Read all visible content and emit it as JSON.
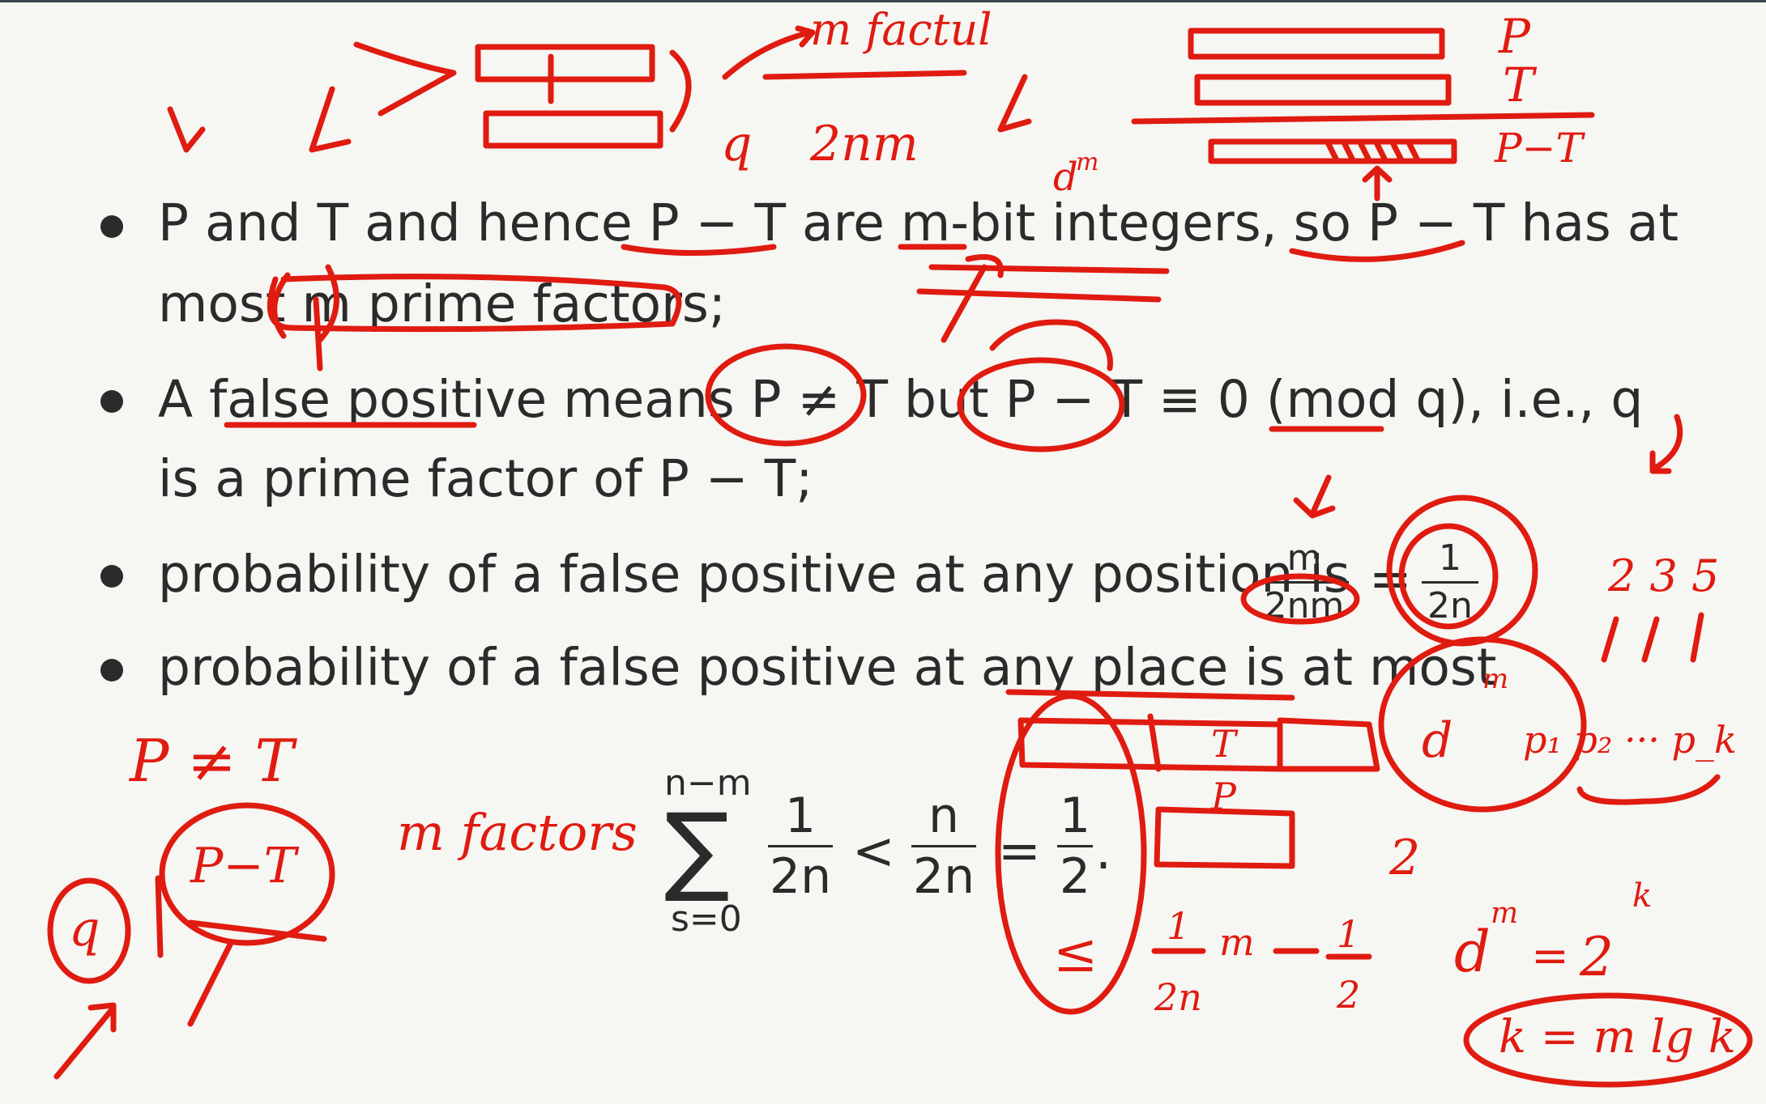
{
  "slide": {
    "bullets": [
      {
        "line1": "P and T and hence P − T are m-bit integers, so P − T has at",
        "line2": "most m prime factors;"
      },
      {
        "line1": "A false positive means P ≠ T but P − T ≡ 0 (mod q), i.e., q",
        "line2": "is a prime factor of P − T;"
      },
      {
        "line1": "probability of a false positive at any position is",
        "frac1_num": "m",
        "frac1_den": "2nm",
        "equals": "=",
        "frac2_num": "1",
        "frac2_den": "2n"
      },
      {
        "line1": "probability of a false positive at any place is at most"
      }
    ],
    "sum": {
      "upper": "n−m",
      "symbol": "∑",
      "lower": "s=0",
      "frac_a_num": "1",
      "frac_a_den": "2n",
      "lt": "<",
      "frac_b_num": "n",
      "frac_b_den": "2n",
      "eq": "=",
      "frac_c_num": "1",
      "frac_c_den": "2",
      "period": "."
    }
  },
  "annotations": {
    "color": "#e01b10",
    "top_note_1": "m factul",
    "top_note_2": "q",
    "top_note_3": "2nm",
    "top_note_4": "d",
    "top_note_4_sup": "m",
    "right_label_p": "P",
    "right_label_t": "T",
    "right_label_pt": "P−T",
    "left_p_ne_t": "P ≠ T",
    "left_q": "q",
    "left_pt": "P−T",
    "left_m_factors": "m factors",
    "table_t": "T",
    "table_p": "P",
    "le_sign": "≤",
    "half_note_num": "1",
    "half_note_den": "2n",
    "half_note_m": "m",
    "half_note_rhs_num": "1",
    "half_note_rhs_den": "2",
    "right_d": "d",
    "right_d_sup": "m",
    "right_primes": "p₁ p₂ ··· p_k",
    "right_235": "2 3 5",
    "right_2": "2",
    "eq_d": "d",
    "eq_m": "m",
    "eq_eq": "=",
    "eq_2": "2",
    "eq_k": "k",
    "k_formula": "k = m lg k"
  }
}
